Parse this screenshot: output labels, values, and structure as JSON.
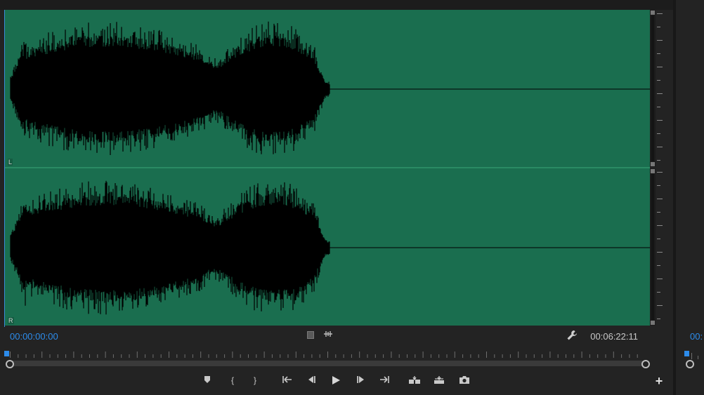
{
  "viewer": {
    "channels": [
      {
        "name": "left",
        "label": "L"
      },
      {
        "name": "right",
        "label": "R"
      }
    ],
    "waveform_color": "#000000",
    "background_color": "#1a6e4f",
    "timecode_current": "00:00:00:00",
    "timecode_duration": "00:06:22:11",
    "accent_color": "#2d8ceb"
  },
  "controls": {
    "fit_icon": "fit-square-icon",
    "marker_icon": "marker-map-icon",
    "settings_icon": "wrench-icon"
  },
  "transport": {
    "buttons": [
      {
        "name": "add-marker-button",
        "icon": "marker-icon"
      },
      {
        "name": "mark-in-button",
        "icon": "mark-in-icon",
        "glyph": "{"
      },
      {
        "name": "mark-out-button",
        "icon": "mark-out-icon",
        "glyph": "}"
      },
      {
        "name": "go-to-in-button",
        "icon": "go-to-in-icon"
      },
      {
        "name": "step-back-button",
        "icon": "step-back-icon"
      },
      {
        "name": "play-button",
        "icon": "play-icon"
      },
      {
        "name": "step-forward-button",
        "icon": "step-forward-icon"
      },
      {
        "name": "go-to-out-button",
        "icon": "go-to-out-icon"
      },
      {
        "name": "insert-button",
        "icon": "insert-icon"
      },
      {
        "name": "overwrite-button",
        "icon": "overwrite-icon"
      },
      {
        "name": "export-frame-button",
        "icon": "camera-icon"
      }
    ],
    "add_label": "+"
  },
  "right_panel": {
    "timecode_fragment": "00:"
  }
}
